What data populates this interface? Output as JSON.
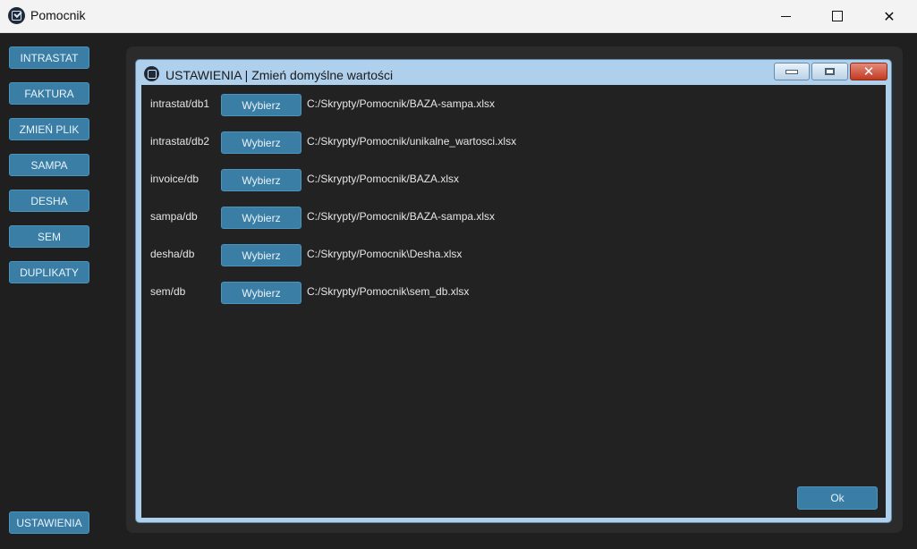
{
  "window": {
    "title": "Pomocnik",
    "icon": "checkbox-app-icon",
    "controls": {
      "minimize": "minimize-icon",
      "maximize": "maximize-icon",
      "close": "✕"
    }
  },
  "sidebar": {
    "items": [
      {
        "label": "INTRASTAT"
      },
      {
        "label": "FAKTURA"
      },
      {
        "label": "ZMIEŃ PLIK"
      },
      {
        "label": "SAMPA"
      },
      {
        "label": "DESHA"
      },
      {
        "label": "SEM"
      },
      {
        "label": "DUPLIKATY"
      }
    ],
    "settings_label": "USTAWIENIA"
  },
  "dialog": {
    "title": "USTAWIENIA | Zmień domyślne wartości",
    "close_glyph": "✕",
    "button_color": "#3a7ea6",
    "rows": [
      {
        "label": "intrastat/db1",
        "button": "Wybierz",
        "path": "C:/Skrypty/Pomocnik/BAZA-sampa.xlsx"
      },
      {
        "label": "intrastat/db2",
        "button": "Wybierz",
        "path": "C:/Skrypty/Pomocnik/unikalne_wartosci.xlsx"
      },
      {
        "label": "invoice/db",
        "button": "Wybierz",
        "path": "C:/Skrypty/Pomocnik/BAZA.xlsx"
      },
      {
        "label": "sampa/db",
        "button": "Wybierz",
        "path": "C:/Skrypty/Pomocnik/BAZA-sampa.xlsx"
      },
      {
        "label": "desha/db",
        "button": "Wybierz",
        "path": "C:/Skrypty/Pomocnik\\Desha.xlsx"
      },
      {
        "label": "sem/db",
        "button": "Wybierz",
        "path": "C:/Skrypty/Pomocnik\\sem_db.xlsx"
      }
    ],
    "ok_label": "Ok"
  }
}
